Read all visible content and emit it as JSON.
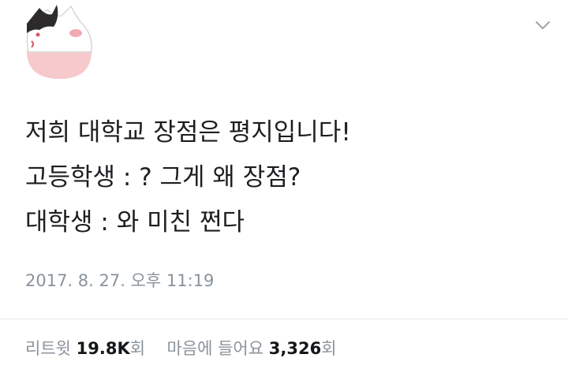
{
  "tweet": {
    "lines": [
      "저희 대학교 장점은 평지입니다!",
      "고등학생 : ? 그게 왜 장점?",
      "대학생 : 와 미친 쩐다"
    ],
    "timestamp": "2017. 8. 27. 오후 11:19"
  },
  "stats": {
    "retweet_label": "리트윗",
    "retweet_count": "19.8K",
    "retweet_unit": "회",
    "like_label": "마음에 들어요",
    "like_count": "3,326",
    "like_unit": "회"
  },
  "icons": {
    "avatar": "cat-avatar-icon",
    "menu": "chevron-down-icon"
  },
  "colors": {
    "text": "#1c1e21",
    "muted": "#8a939b",
    "divider": "#e1e8ed",
    "avatar_pink": "#f6c9cc"
  }
}
